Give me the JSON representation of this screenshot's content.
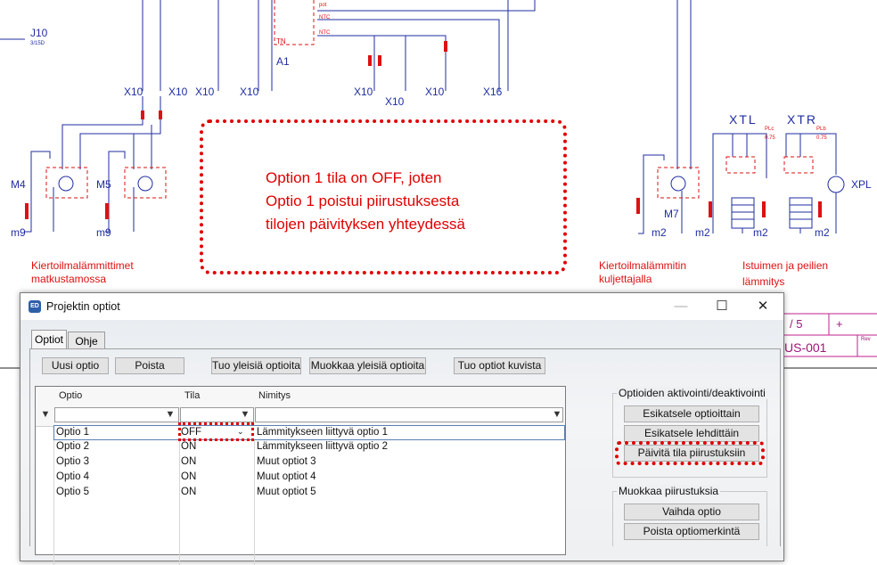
{
  "schematic": {
    "top_labels": {
      "j10": "J10",
      "j10_sub": "3/15D",
      "a1": "A1",
      "tn": "TN",
      "pot": "pot",
      "ntc1": "NTC",
      "ntc2": "NTC"
    },
    "connector_labels": [
      "X10",
      "X10",
      "X10",
      "X10",
      "X10",
      "X10",
      "X10",
      "X16",
      "X10"
    ],
    "motor_labels": {
      "m4": "M4",
      "m5": "M5",
      "m7": "M7",
      "xtl": "XTL",
      "xtr": "XTR",
      "xpl": "XPL"
    },
    "ground_labels": [
      "m9",
      "m9",
      "m2",
      "m2",
      "m2",
      "m2"
    ],
    "wire_small": {
      "plc": "PLc",
      "plb": "PLb",
      "v075a": "0.75",
      "v075b": "0.75"
    },
    "section_labels": {
      "left": [
        "Kiertoilmalämmittimet",
        "matkustamossa"
      ],
      "mid": [
        "Kiertoilmalämmitin",
        "kuljettajalla"
      ],
      "right": [
        "Istuimen ja peilien",
        "lämmitys"
      ]
    },
    "title_block": {
      "page": "/ 5",
      "plus": "+",
      "doc": "US-001",
      "rev": "Rev"
    }
  },
  "callout": {
    "line1": "Option 1 tila on OFF, joten",
    "line2": "Optio 1 poistui piirustuksesta",
    "line3": "tilojen päivityksen yhteydessä"
  },
  "dialog": {
    "title": "Projektin optiot",
    "app_icon": "ED",
    "minimize_icon": "—",
    "maximize_icon": "☐",
    "close_icon": "✕",
    "tabs": [
      {
        "label": "Optiot",
        "active": true
      },
      {
        "label": "Ohje",
        "active": false
      }
    ],
    "toolbar": {
      "new_option": "Uusi optio",
      "delete": "Poista",
      "import_general": "Tuo yleisiä optioita",
      "edit_general": "Muokkaa yleisiä optioita",
      "import_from_images": "Tuo optiot kuvista"
    },
    "grid": {
      "columns": [
        "Optio",
        "Tila",
        "Nimitys"
      ],
      "rows": [
        {
          "optio": "Optio 1",
          "tila": "OFF",
          "nimitys": "Lämmitykseen liittyvä optio 1",
          "selected": true
        },
        {
          "optio": "Optio 2",
          "tila": "ON",
          "nimitys": "Lämmitykseen liittyvä optio 2"
        },
        {
          "optio": "Optio 3",
          "tila": "ON",
          "nimitys": "Muut optiot 3"
        },
        {
          "optio": "Optio 4",
          "tila": "ON",
          "nimitys": "Muut optiot 4"
        },
        {
          "optio": "Optio 5",
          "tila": "ON",
          "nimitys": "Muut optiot 5"
        }
      ]
    },
    "activation_group": {
      "title": "Optioiden aktivointi/deaktivointi",
      "preview_by_option": "Esikatsele optioittain",
      "preview_by_sheet": "Esikatsele lehdittäin",
      "update_state": "Päivitä tila piirustuksiin"
    },
    "edit_group": {
      "title": "Muokkaa piirustuksia",
      "change_option": "Vaihda optio",
      "remove_marking": "Poista optiomerkintä"
    }
  },
  "colors": {
    "schematic_blue": "#1f2ea0",
    "schematic_red": "#d11",
    "highlight": "#e00000"
  }
}
